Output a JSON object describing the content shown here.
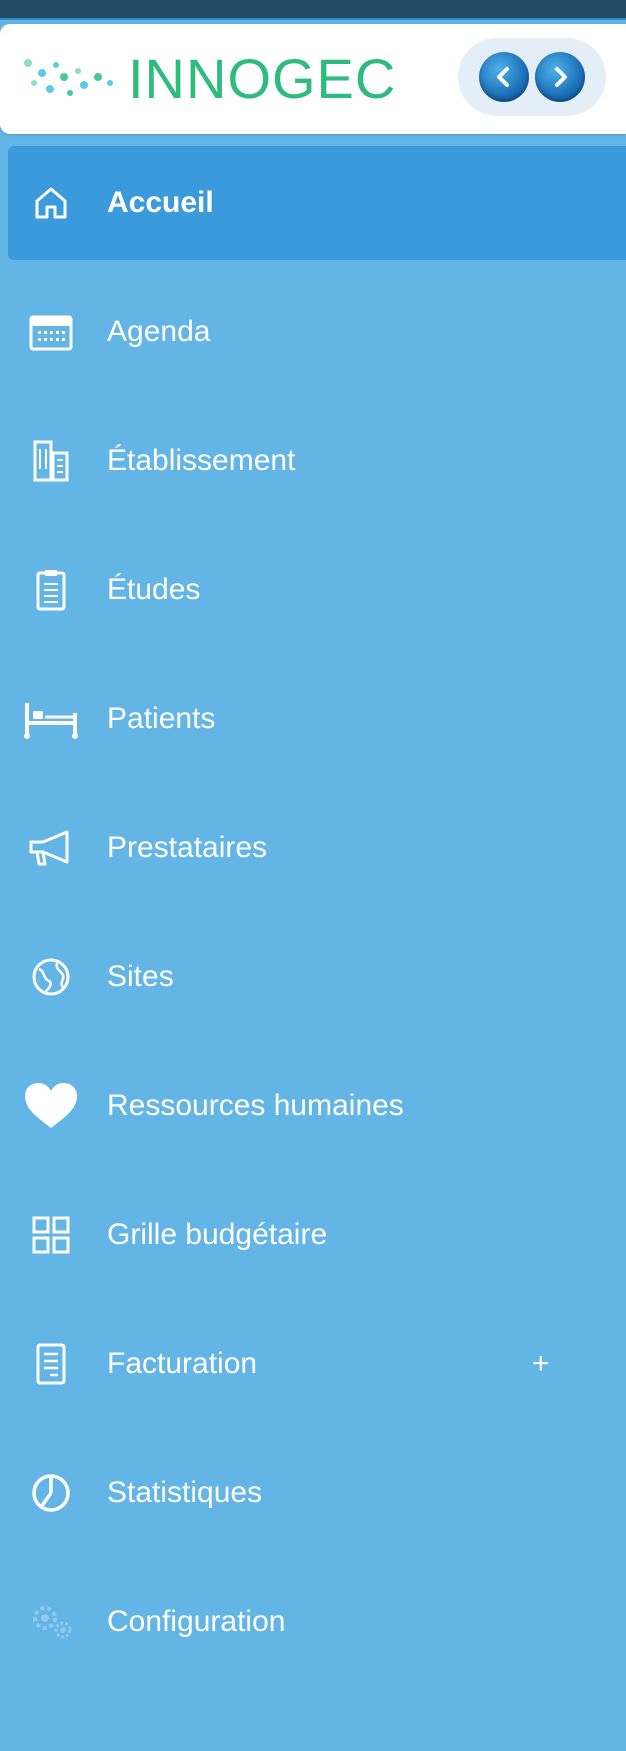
{
  "brand": {
    "name": "INNOGEC"
  },
  "colors": {
    "sidebar_bg": "#63b5e5",
    "active_bg": "#3a9adb",
    "brand_green": "#2dbb7e",
    "top_bar": "#234d66"
  },
  "menu": [
    {
      "label": "Accueil",
      "icon": "home-icon",
      "active": true
    },
    {
      "label": "Agenda",
      "icon": "calendar-icon"
    },
    {
      "label": "Établissement",
      "icon": "building-icon"
    },
    {
      "label": "Études",
      "icon": "clipboard-icon"
    },
    {
      "label": "Patients",
      "icon": "bed-icon"
    },
    {
      "label": "Prestataires",
      "icon": "megaphone-icon"
    },
    {
      "label": "Sites",
      "icon": "globe-icon"
    },
    {
      "label": "Ressources humaines",
      "icon": "heart-icon"
    },
    {
      "label": "Grille budgétaire",
      "icon": "grid-icon"
    },
    {
      "label": "Facturation",
      "icon": "invoice-icon",
      "expand": "+"
    },
    {
      "label": "Statistiques",
      "icon": "pie-chart-icon"
    },
    {
      "label": "Configuration",
      "icon": "gears-icon"
    }
  ]
}
